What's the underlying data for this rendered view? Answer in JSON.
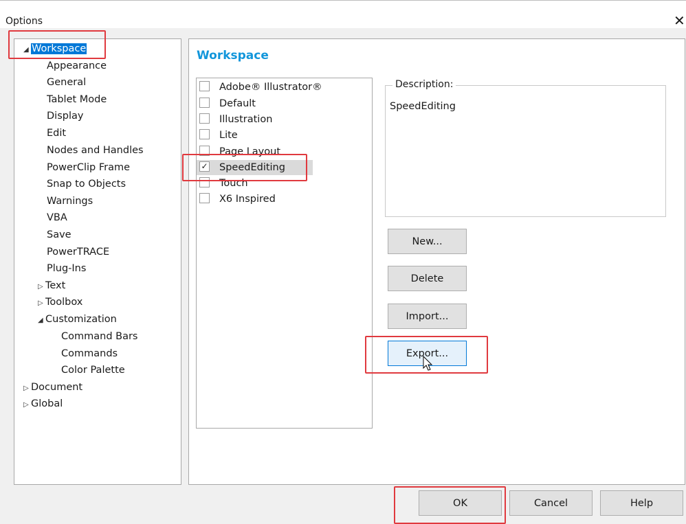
{
  "window": {
    "title": "Options",
    "close_glyph": "✕"
  },
  "tree": [
    {
      "label": "Workspace",
      "arrow": "◢",
      "selected": true
    },
    {
      "label": "Appearance"
    },
    {
      "label": "General"
    },
    {
      "label": "Tablet Mode"
    },
    {
      "label": "Display"
    },
    {
      "label": "Edit"
    },
    {
      "label": "Nodes and Handles"
    },
    {
      "label": "PowerClip Frame"
    },
    {
      "label": "Snap to Objects"
    },
    {
      "label": "Warnings"
    },
    {
      "label": "VBA"
    },
    {
      "label": "Save"
    },
    {
      "label": "PowerTRACE"
    },
    {
      "label": "Plug-Ins"
    },
    {
      "label": "Text",
      "arrow": "▷"
    },
    {
      "label": "Toolbox",
      "arrow": "▷"
    },
    {
      "label": "Customization",
      "arrow": "◢"
    },
    {
      "label": "Command Bars"
    },
    {
      "label": "Commands"
    },
    {
      "label": "Color Palette"
    },
    {
      "label": "Document",
      "arrow": "▷"
    },
    {
      "label": "Global",
      "arrow": "▷"
    }
  ],
  "main": {
    "heading": "Workspace",
    "workspaces": [
      {
        "label": "Adobe® Illustrator®",
        "checked": false
      },
      {
        "label": "Default",
        "checked": false
      },
      {
        "label": "Illustration",
        "checked": false
      },
      {
        "label": "Lite",
        "checked": false
      },
      {
        "label": "Page Layout",
        "checked": false
      },
      {
        "label": "SpeedEditing",
        "checked": true
      },
      {
        "label": "Touch",
        "checked": false
      },
      {
        "label": "X6 Inspired",
        "checked": false
      }
    ],
    "description": {
      "label": "Description:",
      "text": "SpeedEditing"
    },
    "buttons": {
      "new": "New...",
      "delete": "Delete",
      "import": "Import...",
      "export": "Export..."
    }
  },
  "footer": {
    "ok": "OK",
    "cancel": "Cancel",
    "help": "Help"
  },
  "colors": {
    "accent": "#1296db",
    "selection": "#0078d7",
    "highlight": "#e0393e"
  }
}
